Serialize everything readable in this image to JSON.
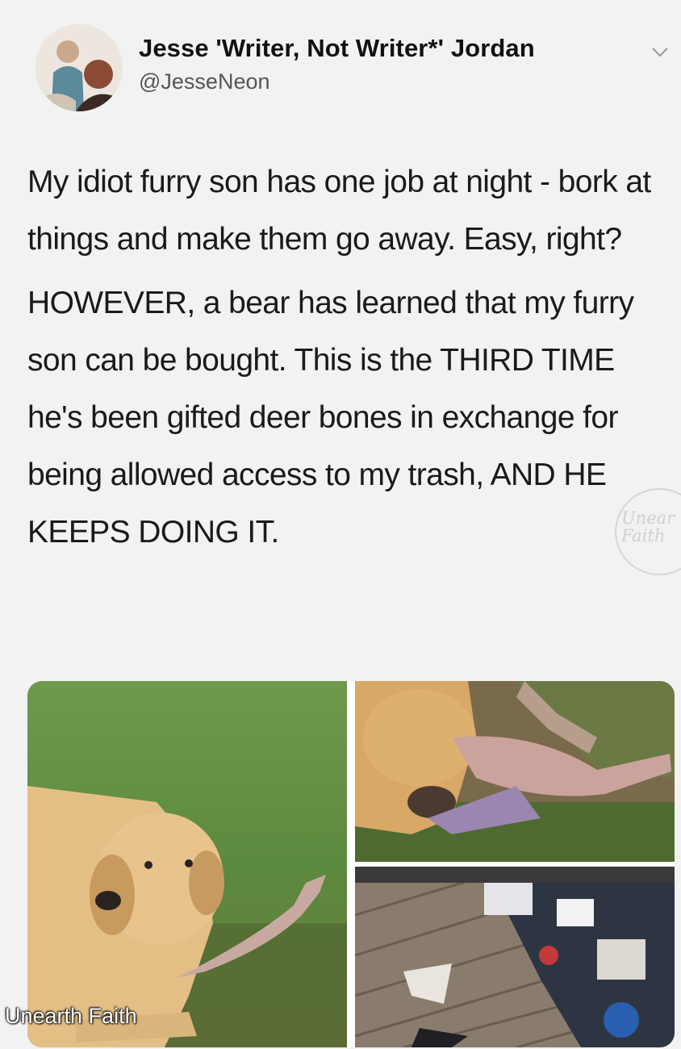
{
  "tweet": {
    "author": {
      "display_name": "Jesse 'Writer, Not Writer*' Jordan",
      "handle": "@JesseNeon",
      "avatar_icon": "profile-photo"
    },
    "menu_icon": "chevron-down-icon",
    "paragraphs": [
      "My idiot furry son has one job at night - bork at things and make them go away. Easy, right?",
      "HOWEVER, a bear has learned that my furry son can be bought. This is the THIRD TIME he's been gifted deer bones in exchange for being allowed access to my trash, AND HE KEEPS DOING IT."
    ],
    "media": [
      {
        "icon": "photo-dog-with-bone"
      },
      {
        "icon": "photo-dog-chewing-bone"
      },
      {
        "icon": "photo-scattered-trash"
      }
    ]
  },
  "watermarks": {
    "side": "Unear Faith",
    "bottom": "Unearth Faith"
  },
  "colors": {
    "background": "#f2f2f2",
    "name": "#111111",
    "handle": "#555555",
    "body": "#1a1a1a"
  }
}
